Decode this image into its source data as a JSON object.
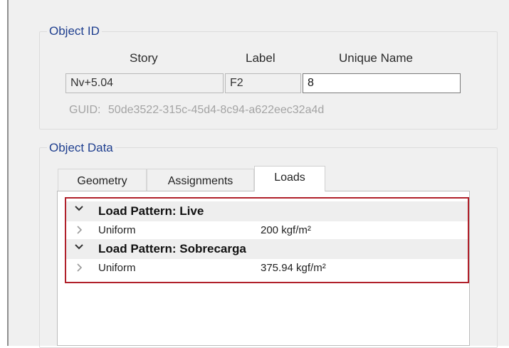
{
  "object_id": {
    "title": "Object ID",
    "headers": {
      "story": "Story",
      "label": "Label",
      "unique_name": "Unique Name"
    },
    "values": {
      "story": "Nv+5.04",
      "label": "F2",
      "unique_name": "8"
    },
    "guid_label": "GUID:",
    "guid_value": "50de3522-315c-45d4-8c94-a622eec32a4d"
  },
  "object_data": {
    "title": "Object Data",
    "tabs": [
      {
        "label": "Geometry",
        "active": false
      },
      {
        "label": "Assignments",
        "active": false
      },
      {
        "label": "Loads",
        "active": true
      }
    ],
    "load_patterns": [
      {
        "label": "Load Pattern: Live",
        "expanded": true,
        "items": [
          {
            "name": "Uniform",
            "value": "200 kgf/m²"
          }
        ]
      },
      {
        "label": "Load Pattern: Sobrecarga",
        "expanded": true,
        "items": [
          {
            "name": "Uniform",
            "value": "375.94 kgf/m²"
          }
        ]
      }
    ]
  },
  "colors": {
    "group_title": "#1f3f8f",
    "highlight_border": "#b0202a",
    "guid_text": "#a4a4a4"
  },
  "icons": {
    "expanded": "chevron-down-icon",
    "collapsed": "chevron-right-icon"
  }
}
